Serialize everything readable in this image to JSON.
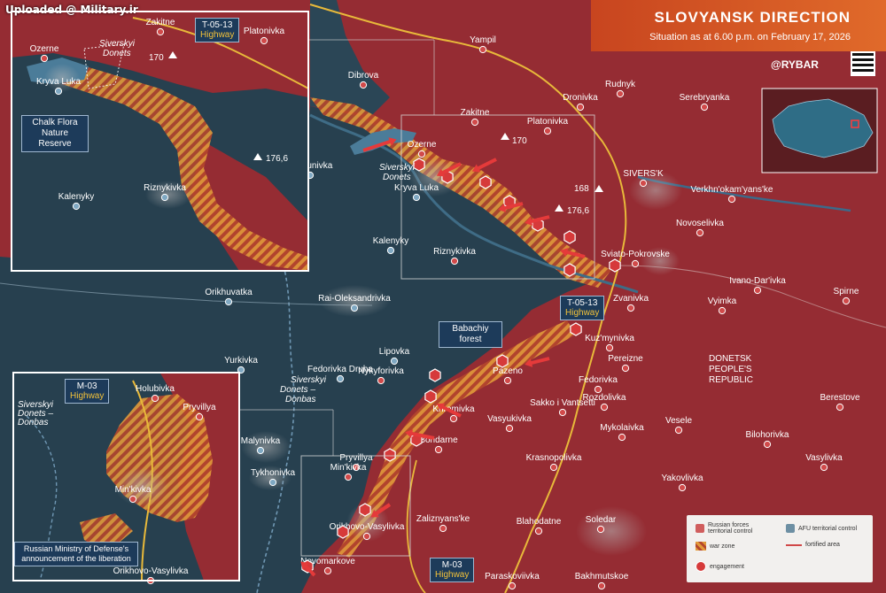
{
  "watermark": "Uploaded @ Military.ir",
  "header": {
    "title": "SLOVYANSK DIRECTION",
    "subtitle": "Situation as at 6.00 p.m. on February 17, 2026"
  },
  "brand": "@RYBAR",
  "colors": {
    "russian_control": "#9b2d33",
    "afu_control": "#27404f",
    "war_zone": "#e29a3a",
    "header": "#d3522a",
    "road": "#e8b93a"
  },
  "places_main": [
    {
      "name": "Yampil"
    },
    {
      "name": "Rudnyk"
    },
    {
      "name": "Dronivka"
    },
    {
      "name": "Serebryanka"
    },
    {
      "name": "Dibrova"
    },
    {
      "name": "Zakitne"
    },
    {
      "name": "Platonivka"
    },
    {
      "name": "Ozerne"
    },
    {
      "name": "Pyskunivka"
    },
    {
      "name": "Kryva Luka"
    },
    {
      "name": "SIVERS'K"
    },
    {
      "name": "Verkhn'okam'yans'ke"
    },
    {
      "name": "Novoselivka"
    },
    {
      "name": "Kalenyky"
    },
    {
      "name": "Riznykivka"
    },
    {
      "name": "Sviato-Pokrovske"
    },
    {
      "name": "Ivano-Dar'ivka"
    },
    {
      "name": "Spirne"
    },
    {
      "name": "Orikhuvatka"
    },
    {
      "name": "Rai-Oleksandrivka"
    },
    {
      "name": "Zvanivka"
    },
    {
      "name": "Vyimka"
    },
    {
      "name": "Kuz'mynivka"
    },
    {
      "name": "Yurkivka"
    },
    {
      "name": "Lipovka"
    },
    {
      "name": "Pazeno"
    },
    {
      "name": "Pereizne"
    },
    {
      "name": "Fedorivka Druha"
    },
    {
      "name": "Nykyforivka"
    },
    {
      "name": "Fedorivka"
    },
    {
      "name": "Khromivka"
    },
    {
      "name": "Sakko i Vantsetti"
    },
    {
      "name": "Rozdolivka"
    },
    {
      "name": "Berestove"
    },
    {
      "name": "Vasyukivka"
    },
    {
      "name": "Vesele"
    },
    {
      "name": "Bondarne"
    },
    {
      "name": "Mykolaivka"
    },
    {
      "name": "Bilohorivka"
    },
    {
      "name": "Malynivka"
    },
    {
      "name": "Pryvillya"
    },
    {
      "name": "Krasnopolivka"
    },
    {
      "name": "Vasylivka"
    },
    {
      "name": "Tykhonivka"
    },
    {
      "name": "Min'kivka"
    },
    {
      "name": "Yakovlivka"
    },
    {
      "name": "Orikhovo-Vasylivka"
    },
    {
      "name": "Zaliznyans'ke"
    },
    {
      "name": "Blahodatne"
    },
    {
      "name": "Soledar"
    },
    {
      "name": "Novomarkove"
    },
    {
      "name": "Paraskoviivka"
    },
    {
      "name": "Bakhmutskoe"
    }
  ],
  "elevations": [
    "170",
    "168",
    "176,6"
  ],
  "region_label": "DONETSK PEOPLE'S REPUBLIC",
  "water_labels": {
    "river_main": "Siverskyi Donets",
    "canal": "Siverskyi Donets – Donbas"
  },
  "forest_label": "Babachiy forest",
  "highways": {
    "t0513_main": {
      "code": "T-05-13",
      "word": "Highway"
    },
    "t0513_inset": {
      "code": "T-05-13",
      "word": "Highway"
    },
    "m03_main": {
      "code": "M-03",
      "word": "Highway"
    },
    "m03_inset": {
      "code": "M-03",
      "word": "Highway"
    }
  },
  "inset_top": {
    "places": [
      "Zakitne",
      "Platonivka",
      "Ozerne",
      "Kryva Luka",
      "Kalenyky",
      "Riznykivka"
    ],
    "river": "Siverskyi Donets",
    "elevations": [
      "170",
      "176,6"
    ],
    "reserve": "Chalk Flora Nature Reserve"
  },
  "inset_bottom": {
    "places": [
      "Holubivka",
      "Pryvillya",
      "Min'kivka",
      "Orikhovo-Vasylivka"
    ],
    "canal": "Siverskyi Donets – Donbas",
    "note": "Russian Ministry of Defense's announcement of the liberation"
  },
  "legend": {
    "russian": "Russian forces territorial control",
    "afu": "AFU territorial control",
    "war_zone": "war zone",
    "fortified": "fortified area",
    "engagement": "engagement"
  }
}
